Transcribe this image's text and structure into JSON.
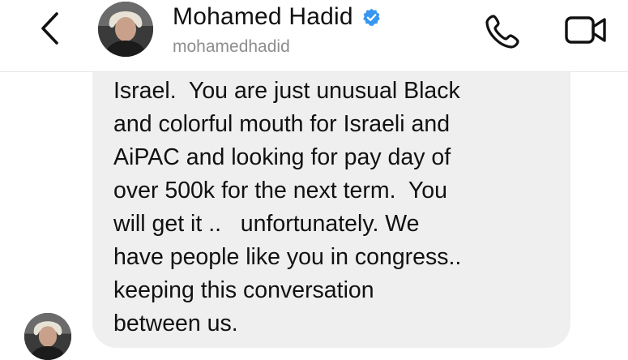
{
  "header": {
    "contact_name": "Mohamed Hadid",
    "username": "mohamedhadid",
    "verified": true,
    "back_icon": "chevron-left-icon",
    "call_icon": "phone-icon",
    "video_icon": "video-camera-icon",
    "verified_color": "#3897f0"
  },
  "conversation": {
    "bubble_color": "#efefef",
    "message": {
      "lines": [
        "Israel.  You are just unusual Black",
        "and colorful mouth for Israeli and",
        "AiPAC and looking for pay day of",
        "over 500k for the next term.  You",
        "will get it ..   unfortunately. We",
        "have people like you in congress..",
        "keeping this conversation",
        "between us."
      ]
    }
  }
}
